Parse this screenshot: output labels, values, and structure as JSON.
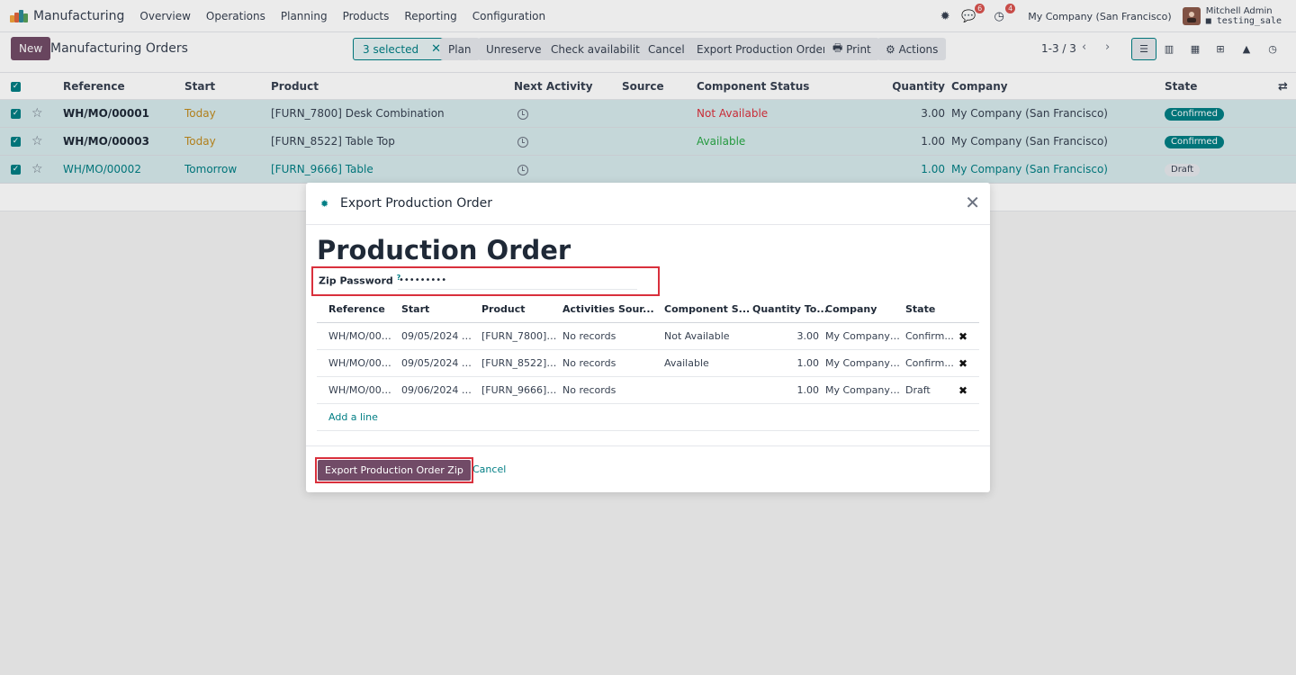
{
  "navbar": {
    "app_name": "Manufacturing",
    "menu": [
      "Overview",
      "Operations",
      "Planning",
      "Products",
      "Reporting",
      "Configuration"
    ],
    "messages_count": "6",
    "activities_count": "4",
    "company": "My Company (San Francisco)",
    "user_name": "Mitchell Admin",
    "db_name": "testing_sale"
  },
  "control_panel": {
    "new_label": "New",
    "breadcrumb": "Manufacturing Orders",
    "selected_label": "3 selected",
    "actions": [
      "Plan",
      "Unreserve",
      "Check availability",
      "Cancel",
      "Export Production Orders",
      "Print",
      "Actions"
    ],
    "pager": "1-3 / 3"
  },
  "list": {
    "headers": [
      "Reference",
      "Start",
      "Product",
      "Next Activity",
      "Source",
      "Component Status",
      "Quantity",
      "Company",
      "State"
    ],
    "rows": [
      {
        "reference": "WH/MO/00001",
        "start": "Today",
        "product": "[FURN_7800] Desk Combination",
        "source": "",
        "component_status": "Not Available",
        "quantity": "3.00",
        "company": "My Company (San Francisco)",
        "state": "Confirmed"
      },
      {
        "reference": "WH/MO/00003",
        "start": "Today",
        "product": "[FURN_8522] Table Top",
        "source": "",
        "component_status": "Available",
        "quantity": "1.00",
        "company": "My Company (San Francisco)",
        "state": "Confirmed"
      },
      {
        "reference": "WH/MO/00002",
        "start": "Tomorrow",
        "product": "[FURN_9666] Table",
        "source": "",
        "component_status": "",
        "quantity": "1.00",
        "company": "My Company (San Francisco)",
        "state": "Draft"
      }
    ]
  },
  "modal": {
    "title": "Export Production Order",
    "form_title": "Production Order",
    "zip_password_label": "Zip Password",
    "zip_password_help": "?",
    "zip_password_value": "•••••••••",
    "headers": [
      "Reference",
      "Start",
      "Product",
      "Activities",
      "Sour...",
      "Component S...",
      "Quantity To...",
      "Company",
      "State"
    ],
    "rows": [
      {
        "reference": "WH/MO/000...",
        "start": "09/05/2024 1...",
        "product": "[FURN_7800] ...",
        "activities": "No records",
        "source": "",
        "component_status": "Not Available",
        "quantity": "3.00",
        "company": "My Company (...",
        "state": "Confirm..."
      },
      {
        "reference": "WH/MO/000...",
        "start": "09/05/2024 1...",
        "product": "[FURN_8522] ...",
        "activities": "No records",
        "source": "",
        "component_status": "Available",
        "quantity": "1.00",
        "company": "My Company (...",
        "state": "Confirm..."
      },
      {
        "reference": "WH/MO/000...",
        "start": "09/06/2024 1...",
        "product": "[FURN_9666] ...",
        "activities": "No records",
        "source": "",
        "component_status": "",
        "quantity": "1.00",
        "company": "My Company (...",
        "state": "Draft"
      }
    ],
    "add_line_label": "Add a line",
    "export_button": "Export Production Order Zip",
    "cancel_button": "Cancel"
  },
  "colors": {
    "primary": "#714b67",
    "accent": "#017e84",
    "danger": "#d9303c",
    "warning": "#e5a33b",
    "success": "#28a745"
  }
}
